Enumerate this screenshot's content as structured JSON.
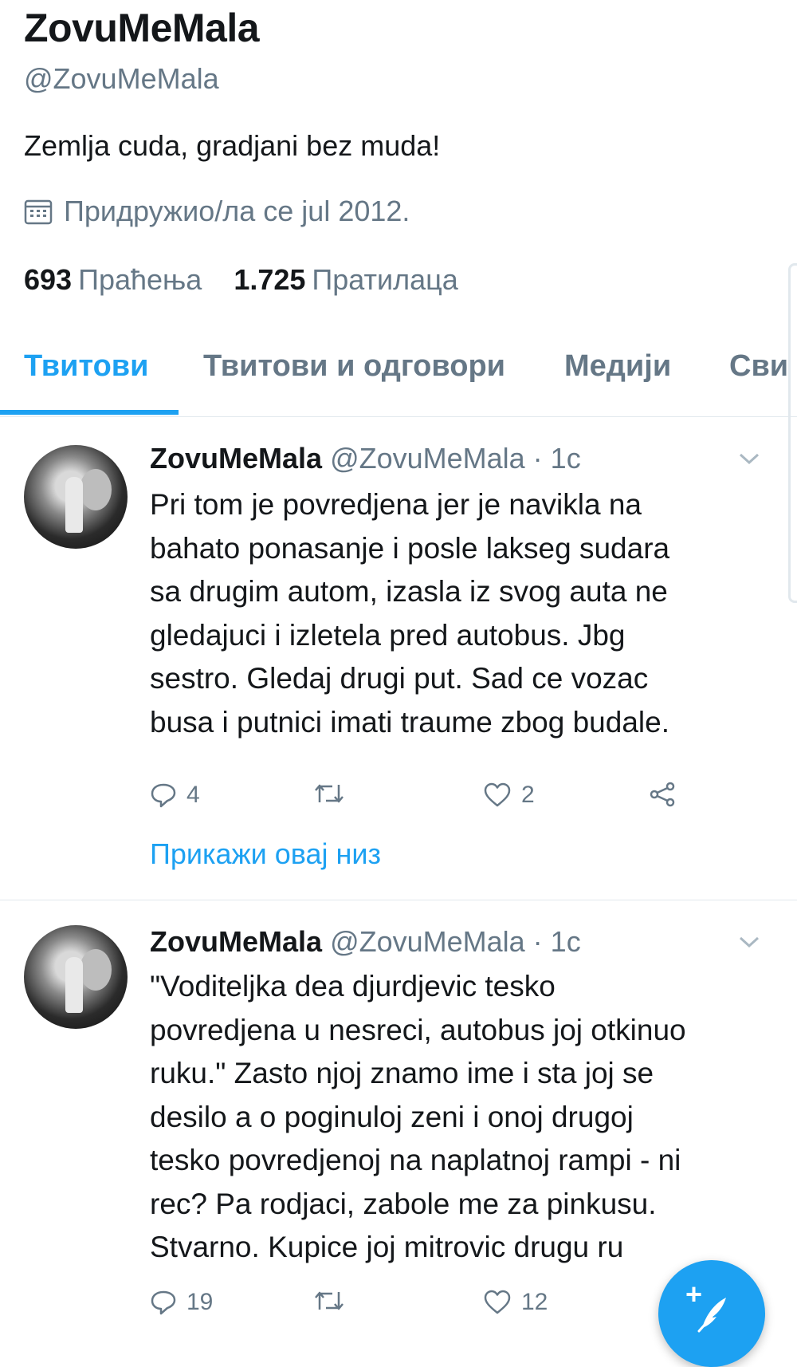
{
  "profile": {
    "name": "ZovuMeMala",
    "handle": "@ZovuMeMala",
    "bio": "Zemlja cuda, gradjani bez muda!",
    "joined": "Придружио/ла се jul 2012.",
    "following_count": "693",
    "following_label": "Праћења",
    "followers_count": "1.725",
    "followers_label": "Пратилаца"
  },
  "tabs": [
    {
      "label": "Твитови",
      "active": true
    },
    {
      "label": "Твитови и одговори",
      "active": false
    },
    {
      "label": "Медији",
      "active": false
    },
    {
      "label": "Сви",
      "active": false
    }
  ],
  "tweets": [
    {
      "name": "ZovuMeMala",
      "meta": "@ZovuMeMala · 1с",
      "lines": [
        "Pri tom je povredjena jer je navikla na",
        "bahato ponasanje i posle lakseg sudara",
        "sa drugim autom, izasla iz svog auta ne",
        "gledajuci i izletela pred autobus. Jbg",
        "sestro. Gledaj drugi put. Sad ce vozac",
        "busa i putnici imati traume zbog budale."
      ],
      "replies": "4",
      "retweets": "",
      "likes": "2",
      "thread_link": "Прикажи овај низ"
    },
    {
      "name": "ZovuMeMala",
      "meta": "@ZovuMeMala · 1с",
      "lines": [
        "\"Voditeljka dea djurdjevic tesko",
        "povredjena u nesreci, autobus joj otkinuo",
        "ruku.\" Zasto njoj znamo ime i sta joj se",
        "desilo a o poginuloj zeni i onoj drugoj",
        "tesko povredjenoj na naplatnoj rampi - ni",
        "rec? Pa rodjaci, zabole me za pinkusu.",
        "Stvarno. Kupice joj mitrovic drugu ru"
      ],
      "replies": "19",
      "retweets": "",
      "likes": "12"
    }
  ],
  "colors": {
    "accent": "#1da1f2",
    "text": "#14171a",
    "secondary": "#657786",
    "divider": "#e1e8ed"
  },
  "icons": [
    "calendar-icon",
    "chevron-down-icon",
    "reply-icon",
    "retweet-icon",
    "like-icon",
    "share-icon",
    "compose-icon"
  ]
}
